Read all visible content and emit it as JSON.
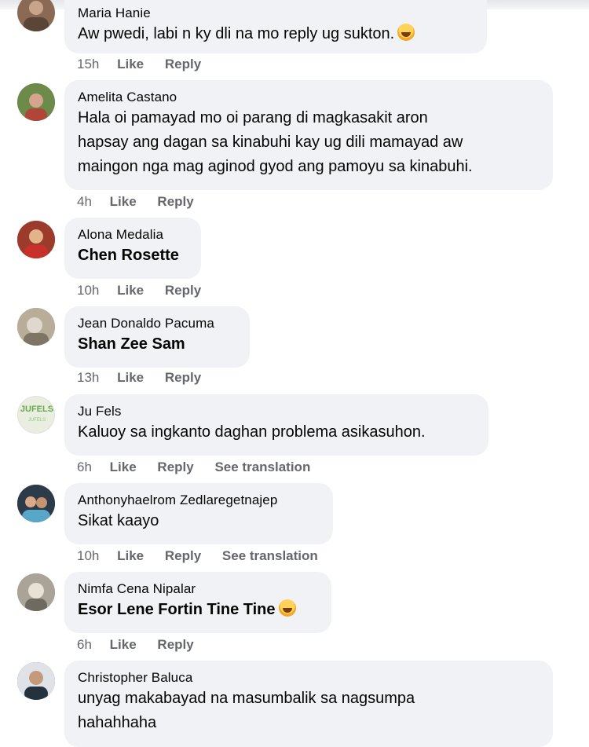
{
  "comments": [
    {
      "author": "Maria Hanie",
      "text": "Aw pwedi, labi n ky dli na mo reply ug sukton.",
      "emoji": "rolling-on-floor-laughing-emoji",
      "time": "15h",
      "actions": [
        "Like",
        "Reply"
      ],
      "avatar_color": "#8a6a55"
    },
    {
      "author": "Amelita Castano",
      "lines": [
        "Hala oi pamayad mo oi parang di magkasakit aron",
        "hapsay ang dagan sa kinabuhi kay ug dili mamayad aw",
        "maingon nga mag aginod gyod ang pamoyu sa kinabuhi."
      ],
      "time": "4h",
      "actions": [
        "Like",
        "Reply"
      ],
      "avatar_color": "#4f7a3a"
    },
    {
      "author": "Alona Medalia",
      "text": "Chen Rosette",
      "time": "10h",
      "actions": [
        "Like",
        "Reply"
      ],
      "avatar_color": "#b3412f"
    },
    {
      "author": "Jean Donaldo Pacuma",
      "text": "Shan Zee Sam",
      "time": "13h",
      "actions": [
        "Like",
        "Reply"
      ],
      "avatar_color": "#9b8f7c"
    },
    {
      "author": "Ju Fels",
      "text": "Kaluoy sa ingkanto daghan problema asikasuhon.",
      "time": "6h",
      "actions": [
        "Like",
        "Reply",
        "See translation"
      ],
      "avatar_color": "#e8efe0",
      "avatar_text": "JUFELS"
    },
    {
      "author": "Anthonyhaelrom Zedlaregetnajep",
      "text": "Sikat kaayo",
      "time": "10h",
      "actions": [
        "Like",
        "Reply",
        "See translation"
      ],
      "avatar_color": "#3a4e63"
    },
    {
      "author": "Nimfa Cena Nipalar",
      "text": "Esor Lene Fortin Tine Tine",
      "emoji": "rolling-on-floor-laughing-emoji",
      "time": "6h",
      "actions": [
        "Like",
        "Reply"
      ],
      "avatar_color": "#8d8a80"
    },
    {
      "author": "Christopher Baluca",
      "lines": [
        "unyag makabayad na masumbalik sa nagsumpa",
        "hahahhaha"
      ],
      "avatar_color": "#2f3a44"
    }
  ]
}
